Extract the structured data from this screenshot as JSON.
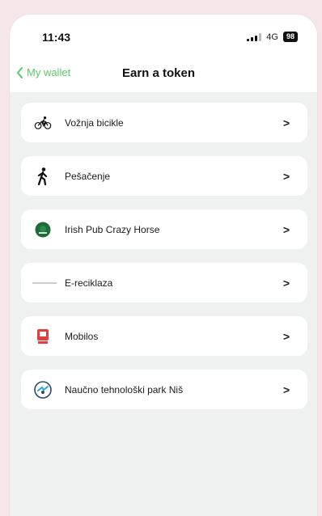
{
  "status": {
    "time": "11:43",
    "network": "4G",
    "battery": "98"
  },
  "nav": {
    "back_label": "My wallet",
    "title": "Earn a token"
  },
  "items": [
    {
      "label": "Vožnja bicikle",
      "icon": "bicycle-icon",
      "chevron": ">"
    },
    {
      "label": "Pešačenje",
      "icon": "walking-icon",
      "chevron": ">"
    },
    {
      "label": "Irish Pub Crazy Horse",
      "icon": "irish-pub-logo-icon",
      "chevron": ">"
    },
    {
      "label": "E-reciklaza",
      "icon": "e-reciklaza-logo-icon",
      "chevron": ">"
    },
    {
      "label": "Mobilos",
      "icon": "mobilos-logo-icon",
      "chevron": ">"
    },
    {
      "label": "Naučno tehnološki park Niš",
      "icon": "ntp-nis-logo-icon",
      "chevron": ">"
    }
  ],
  "colors": {
    "accent": "#59c96a",
    "background": "#eef1ef",
    "outer": "#f6e6ea"
  }
}
